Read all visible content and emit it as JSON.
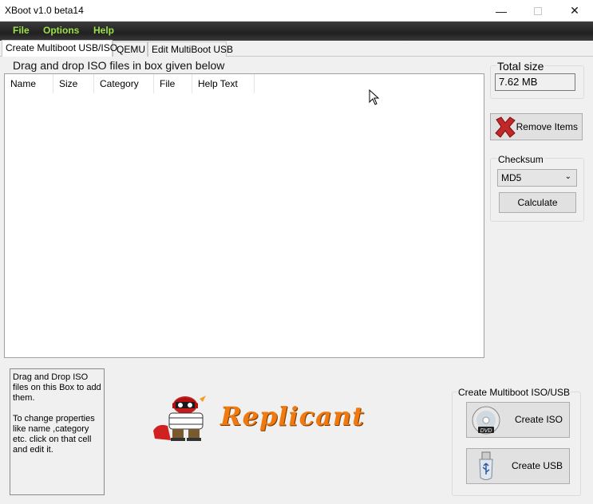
{
  "window": {
    "title": "XBoot v1.0 beta14"
  },
  "menu": [
    "File",
    "Options",
    "Help"
  ],
  "tabs": [
    "Create Multiboot USB/ISO",
    "QEMU",
    "Edit MultiBoot USB"
  ],
  "main": {
    "drop_hint": "Drag and drop ISO files in box given below",
    "columns": [
      "Name",
      "Size",
      "Category",
      "File",
      "Help Text"
    ],
    "help_lines": [
      "Drag and Drop ISO files on this Box to add them.",
      "To change properties like name ,category etc. click on that cell and edit it."
    ],
    "logo_text": "Replicant"
  },
  "side": {
    "total_size_label": "Total size",
    "total_size_value": "7.62 MB",
    "remove_label": "Remove Items",
    "checksum_label": "Checksum",
    "checksum_selected": "MD5",
    "calculate_label": "Calculate",
    "create_group_label": "Create Multiboot ISO/USB",
    "create_iso_label": "Create ISO",
    "create_usb_label": "Create USB"
  },
  "icons": {
    "remove": "red-x-icon",
    "iso": "dvd-icon",
    "usb": "usb-drive-icon"
  },
  "colors": {
    "menu_text": "#9de04a",
    "logo": "#f07a10",
    "remove_x": "#c0282a"
  }
}
